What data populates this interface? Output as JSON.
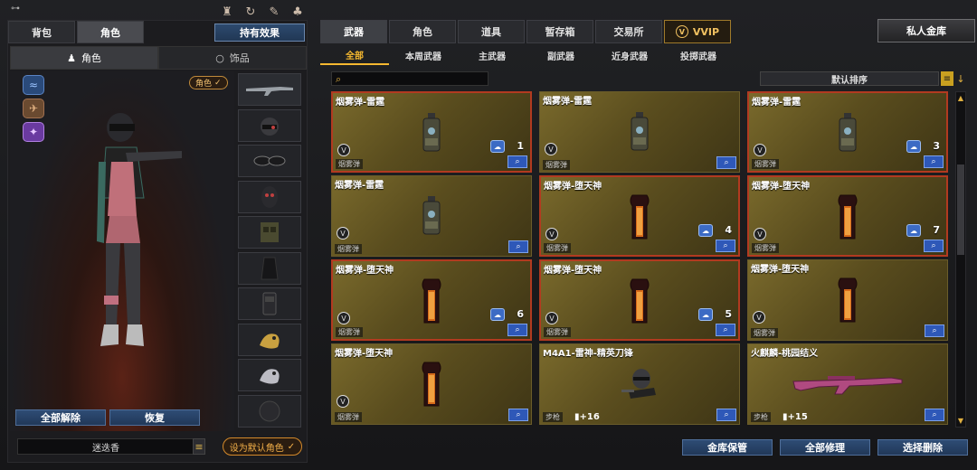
{
  "left": {
    "tabs": [
      "背包",
      "角色"
    ],
    "effect_button": "持有效果",
    "subtabs": [
      "角色",
      "饰品"
    ],
    "role_tag": "角色",
    "unequip_all": "全部解除",
    "restore": "恢复",
    "character_name": "迷迭香",
    "set_default": "设为默认角色"
  },
  "right": {
    "main_tabs": [
      "武器",
      "角色",
      "道具",
      "暂存箱",
      "交易所",
      "VVIP"
    ],
    "vault_button": "私人金库",
    "filter_tabs": [
      "全部",
      "本周武器",
      "主武器",
      "副武器",
      "近身武器",
      "投掷武器"
    ],
    "sort_label": "默认排序",
    "cards": [
      {
        "title": "烟雾弹-雷霆",
        "cat": "烟雾弹",
        "count": "1",
        "item": "grenade-thunder",
        "red": true
      },
      {
        "title": "烟雾弹-雷霆",
        "cat": "烟雾弹",
        "count": "",
        "item": "grenade-thunder",
        "red": false
      },
      {
        "title": "烟雾弹-雷霆",
        "cat": "烟雾弹",
        "count": "3",
        "item": "grenade-thunder",
        "red": true
      },
      {
        "title": "烟雾弹-雷霆",
        "cat": "烟雾弹",
        "count": "",
        "item": "grenade-thunder",
        "red": false
      },
      {
        "title": "烟雾弹-堕天神",
        "cat": "烟雾弹",
        "count": "4",
        "item": "grenade-fallen",
        "red": true
      },
      {
        "title": "烟雾弹-堕天神",
        "cat": "烟雾弹",
        "count": "7",
        "item": "grenade-fallen",
        "red": true
      },
      {
        "title": "烟雾弹-堕天神",
        "cat": "烟雾弹",
        "count": "6",
        "item": "grenade-fallen",
        "red": true
      },
      {
        "title": "烟雾弹-堕天神",
        "cat": "烟雾弹",
        "count": "5",
        "item": "grenade-fallen",
        "red": true
      },
      {
        "title": "烟雾弹-堕天神",
        "cat": "烟雾弹",
        "count": "",
        "item": "grenade-fallen",
        "red": false
      },
      {
        "title": "烟雾弹-堕天神",
        "cat": "烟雾弹",
        "count": "",
        "item": "grenade-fallen",
        "red": false
      },
      {
        "title": "M4A1-雷神-精英刀锋",
        "cat": "步枪",
        "count": "",
        "plus": "+16",
        "item": "rifle-elite",
        "red": false
      },
      {
        "title": "火麒麟-桃园结义",
        "cat": "步枪",
        "count": "",
        "plus": "+15",
        "item": "rifle-pink",
        "red": false
      }
    ],
    "bottom_buttons": [
      "金库保管",
      "全部修理",
      "选择删除"
    ]
  },
  "colors": {
    "accent": "#f5b830",
    "card_gold": "#7a6a2c",
    "button_blue": "#2e4c75",
    "red_border": "#b23a20"
  }
}
